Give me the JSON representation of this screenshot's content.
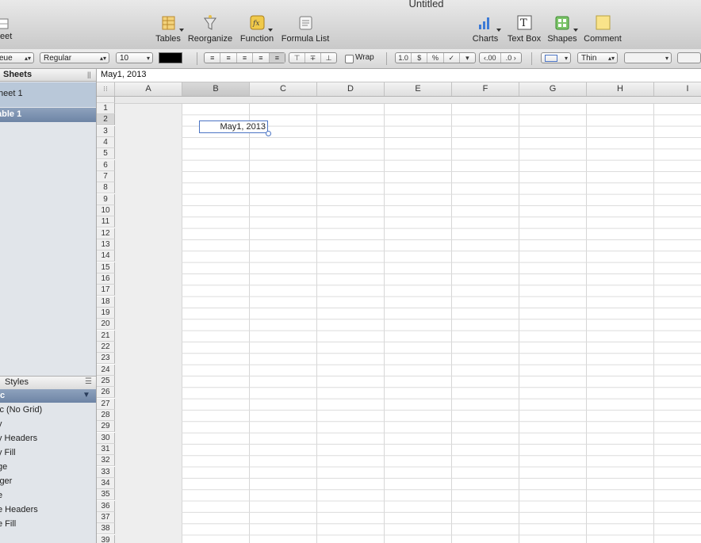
{
  "window": {
    "title": "Untitled"
  },
  "toolbar": {
    "left_partial": "eet",
    "items": [
      {
        "label": "Tables",
        "icon": "tables-icon"
      },
      {
        "label": "Reorganize",
        "icon": "reorganize-icon"
      },
      {
        "label": "Function",
        "icon": "function-icon"
      },
      {
        "label": "Formula List",
        "icon": "formula-list-icon"
      },
      {
        "label": "Charts",
        "icon": "charts-icon"
      },
      {
        "label": "Text Box",
        "icon": "text-box-icon"
      },
      {
        "label": "Shapes",
        "icon": "shapes-icon"
      },
      {
        "label": "Comment",
        "icon": "comment-icon"
      }
    ]
  },
  "formatbar": {
    "font_family": "eue",
    "font_style": "Regular",
    "font_size": "10",
    "text_color": "#000000",
    "wrap_label": "Wrap",
    "num_buttons": [
      "1.0",
      "$",
      "%",
      "✓",
      "▾"
    ],
    "decimal_buttons": [
      "‹.00",
      ".0 ›"
    ],
    "stroke_label": "Thin"
  },
  "sidebar": {
    "sheets_label": "Sheets",
    "sheet_name": "heet 1",
    "table_name": "able 1",
    "styles_label": "Styles",
    "styles": [
      "ic",
      "ic (No Grid)",
      "y",
      "y Headers",
      "y Fill",
      "ge",
      "lger",
      "e",
      "e Headers",
      "e Fill"
    ]
  },
  "formula_bar": {
    "text": "May1, 2013"
  },
  "grid": {
    "columns": [
      "A",
      "B",
      "C",
      "D",
      "E",
      "F",
      "G",
      "H",
      "I"
    ],
    "selected_column": "B",
    "selected_row": 2,
    "rows": 40,
    "cell_B2": "May1, 2013"
  },
  "colors": {
    "selection": "#4b74c4",
    "table_row": "#7389a9",
    "sheet_row": "#b9c8d9"
  }
}
